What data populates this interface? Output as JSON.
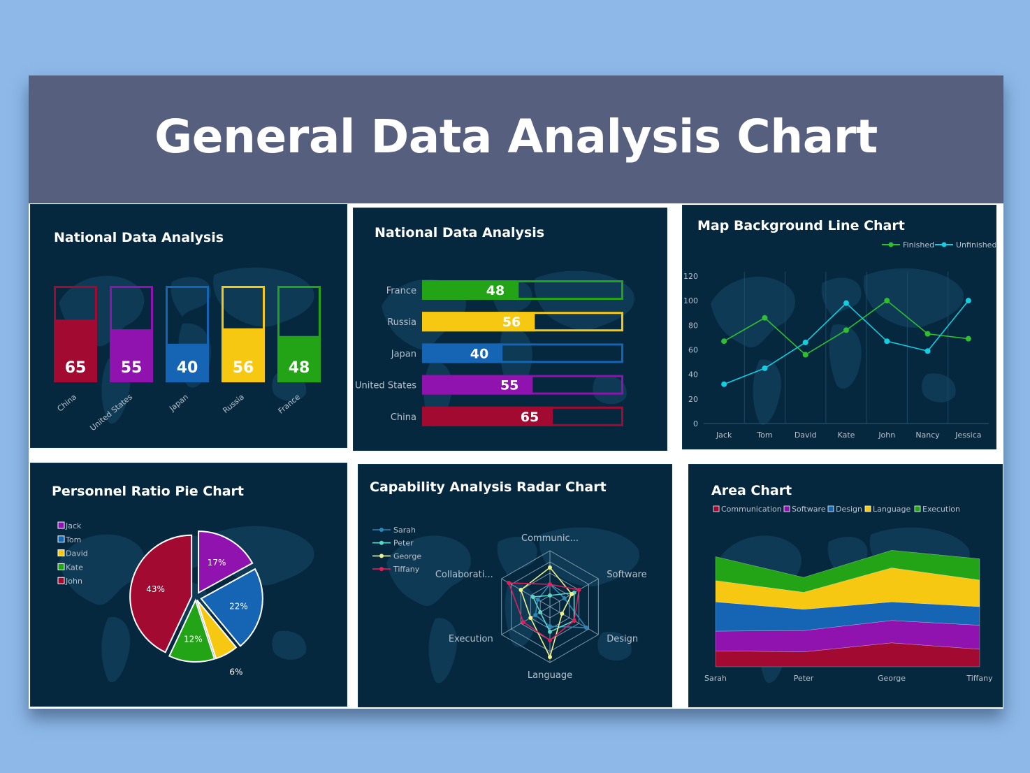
{
  "page": {
    "title": "General Data Analysis Chart"
  },
  "colors": {
    "background": "#8db8e8",
    "header": "#56607e",
    "panel": "#05283f",
    "red": "#a30a32",
    "purple": "#9013b0",
    "blue": "#1565b4",
    "yellow": "#f7c811",
    "green": "#22a416",
    "line_green": "#2fc030",
    "line_cyan": "#13cde0"
  },
  "chart_data": [
    {
      "id": "column",
      "type": "bar",
      "title": "National Data Analysis",
      "categories": [
        "China",
        "United States",
        "Japan",
        "Russia",
        "France"
      ],
      "values": [
        65,
        55,
        40,
        56,
        48
      ],
      "colors": [
        "#a30a32",
        "#9013b0",
        "#1565b4",
        "#f7c811",
        "#22a416"
      ],
      "ylim": [
        0,
        100
      ]
    },
    {
      "id": "hbar",
      "type": "bar",
      "orientation": "horizontal",
      "title": "National Data Analysis",
      "categories": [
        "France",
        "Russia",
        "Japan",
        "United States",
        "China"
      ],
      "values": [
        48,
        56,
        40,
        55,
        65
      ],
      "colors": [
        "#22a416",
        "#f7c811",
        "#1565b4",
        "#9013b0",
        "#a30a32"
      ],
      "xlim": [
        0,
        100
      ]
    },
    {
      "id": "line",
      "type": "line",
      "title": "Map Background Line Chart",
      "x": [
        "Jack",
        "Tom",
        "David",
        "Kate",
        "John",
        "Nancy",
        "Jessica"
      ],
      "series": [
        {
          "name": "Finished",
          "color": "#2fc030",
          "values": [
            67,
            86,
            56,
            76,
            100,
            73,
            69
          ]
        },
        {
          "name": "Unfinished",
          "color": "#13cde0",
          "values": [
            32,
            45,
            66,
            98,
            67,
            59,
            100
          ]
        }
      ],
      "ylim": [
        0,
        120
      ],
      "yticks": [
        0,
        20,
        40,
        60,
        80,
        100,
        120
      ],
      "legend": "top-right"
    },
    {
      "id": "pie",
      "type": "pie",
      "title": "Personnel Ratio Pie Chart",
      "labels": [
        "Jack",
        "Tom",
        "David",
        "Kate",
        "John"
      ],
      "values": [
        17,
        22,
        6,
        12,
        43
      ],
      "display": [
        "17%",
        "22%",
        "6%",
        "12%",
        "43%"
      ],
      "colors": [
        "#9013b0",
        "#1565b4",
        "#f7c811",
        "#22a416",
        "#a30a32"
      ],
      "legend": "left"
    },
    {
      "id": "radar",
      "type": "radar",
      "title": "Capability Analysis Radar Chart",
      "axes": [
        "Communic...",
        "Software",
        "Design",
        "Language",
        "Execution",
        "Collaborati..."
      ],
      "series": [
        {
          "name": "Sarah",
          "color": "#2c86b8",
          "values": [
            40,
            30,
            75,
            35,
            30,
            25
          ]
        },
        {
          "name": "Peter",
          "color": "#5fd4c8",
          "values": [
            20,
            50,
            50,
            45,
            20,
            35
          ]
        },
        {
          "name": "George",
          "color": "#f0f28a",
          "values": [
            70,
            45,
            25,
            90,
            40,
            60
          ]
        },
        {
          "name": "Tiffany",
          "color": "#e01e5a",
          "values": [
            40,
            60,
            50,
            60,
            55,
            85
          ]
        }
      ],
      "max": 100,
      "legend": "top-left"
    },
    {
      "id": "area",
      "type": "area",
      "stacked": true,
      "title": "Area Chart",
      "x": [
        "Sarah",
        "Peter",
        "George",
        "Tiffany"
      ],
      "series": [
        {
          "name": "Communication",
          "color": "#a30a32",
          "values": [
            30,
            28,
            45,
            33
          ]
        },
        {
          "name": "Software",
          "color": "#9013b0",
          "values": [
            37,
            40,
            42,
            45
          ]
        },
        {
          "name": "Design",
          "color": "#1565b4",
          "values": [
            55,
            40,
            35,
            35
          ]
        },
        {
          "name": "Language",
          "color": "#f7c811",
          "values": [
            40,
            32,
            64,
            50
          ]
        },
        {
          "name": "Execution",
          "color": "#22a416",
          "values": [
            45,
            28,
            33,
            40
          ]
        }
      ],
      "legend": "top"
    }
  ]
}
